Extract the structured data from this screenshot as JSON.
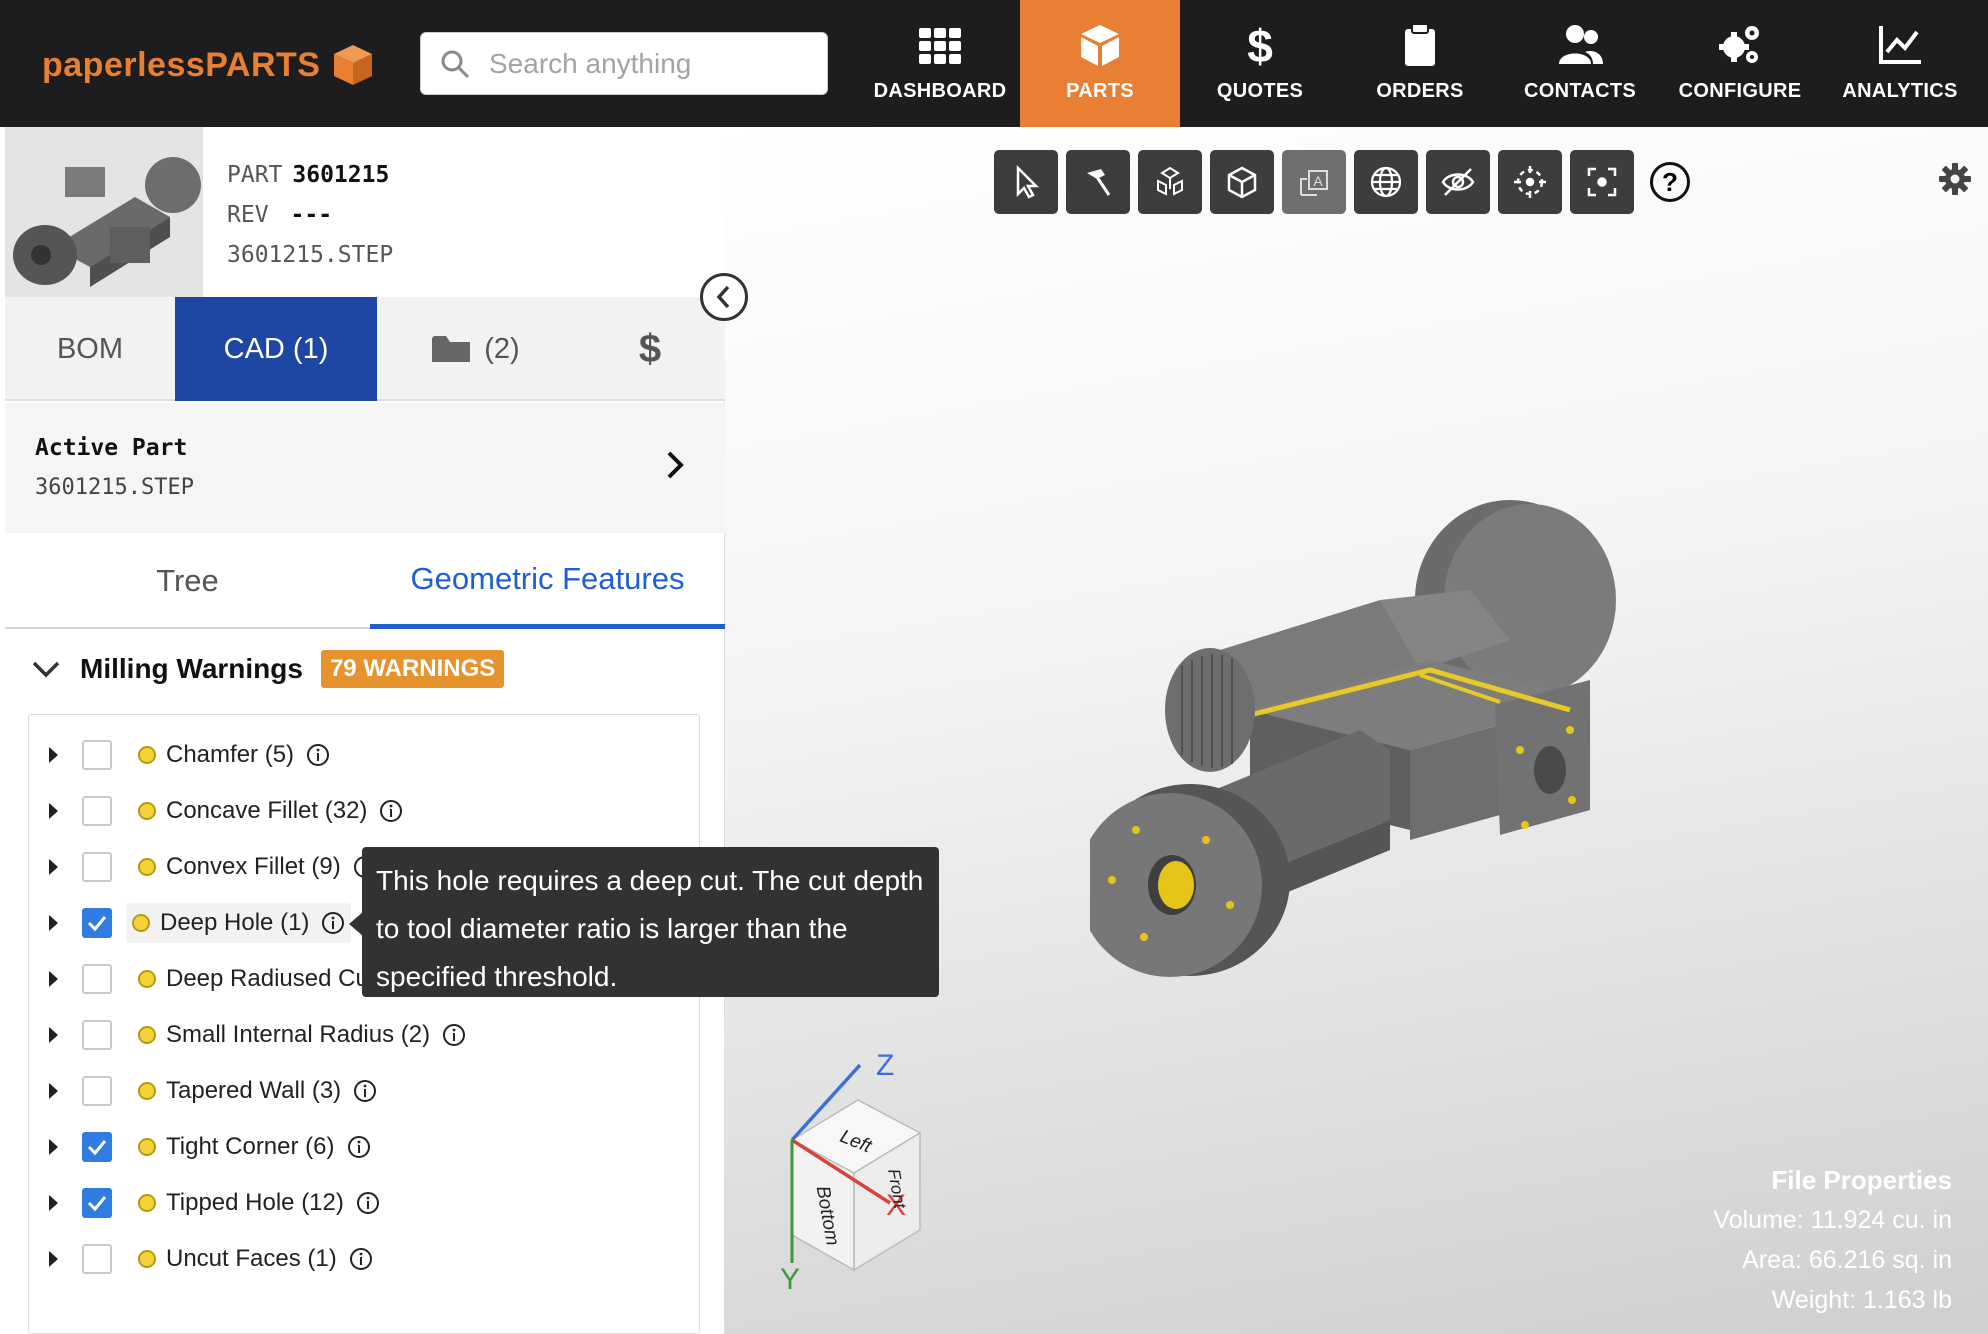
{
  "brand": {
    "name": "paperlessPARTS",
    "color": "#e87f33"
  },
  "search": {
    "placeholder": "Search anything"
  },
  "nav": [
    {
      "label": "DASHBOARD",
      "icon": "grid-icon",
      "active": false
    },
    {
      "label": "PARTS",
      "icon": "cube-icon",
      "active": true
    },
    {
      "label": "QUOTES",
      "icon": "dollar-icon",
      "active": false
    },
    {
      "label": "ORDERS",
      "icon": "clipboard-icon",
      "active": false
    },
    {
      "label": "CONTACTS",
      "icon": "users-icon",
      "active": false
    },
    {
      "label": "CONFIGURE",
      "icon": "gears-icon",
      "active": false
    },
    {
      "label": "ANALYTICS",
      "icon": "chart-icon",
      "active": false
    }
  ],
  "part": {
    "part_label": "PART",
    "part_number": "3601215",
    "rev_label": "REV",
    "rev_value": "---",
    "filename": "3601215.STEP"
  },
  "tabs": {
    "bom": "BOM",
    "cad": "CAD (1)",
    "files": "(2)",
    "cost": "$"
  },
  "active_part": {
    "title": "Active Part",
    "file": "3601215.STEP"
  },
  "subtabs": {
    "tree": "Tree",
    "geometric": "Geometric Features"
  },
  "warnings": {
    "title": "Milling Warnings",
    "badge": "79 WARNINGS",
    "badge_color": "#e6932e"
  },
  "features": [
    {
      "label": "Chamfer (5)",
      "checked": false
    },
    {
      "label": "Concave Fillet (32)",
      "checked": false
    },
    {
      "label": "Convex Fillet (9)",
      "checked": false
    },
    {
      "label": "Deep Hole (1)",
      "checked": true
    },
    {
      "label": "Deep Radiused Cu",
      "checked": false
    },
    {
      "label": "Small Internal Radius (2)",
      "checked": false
    },
    {
      "label": "Tapered Wall (3)",
      "checked": false
    },
    {
      "label": "Tight Corner (6)",
      "checked": true
    },
    {
      "label": "Tipped Hole (12)",
      "checked": true
    },
    {
      "label": "Uncut Faces (1)",
      "checked": false
    }
  ],
  "tooltip": {
    "text": "This hole requires a deep cut. The cut depth to tool diameter ratio is larger than the specified threshold."
  },
  "viewer": {
    "tools": [
      "select-icon",
      "measure-icon",
      "explode-icon",
      "solid-view-icon",
      "annotation-icon",
      "globe-icon",
      "hide-icon",
      "center-icon",
      "fit-icon"
    ],
    "help": "?",
    "axes": {
      "x": "X",
      "y": "Y",
      "z": "Z",
      "faces": {
        "left": "Left",
        "bottom": "Bottom",
        "front": "Front"
      }
    }
  },
  "file_properties": {
    "title": "File Properties",
    "volume": "Volume: 11.924 cu. in",
    "area": "Area: 66.216 sq. in",
    "weight": "Weight: 1.163 lb"
  }
}
